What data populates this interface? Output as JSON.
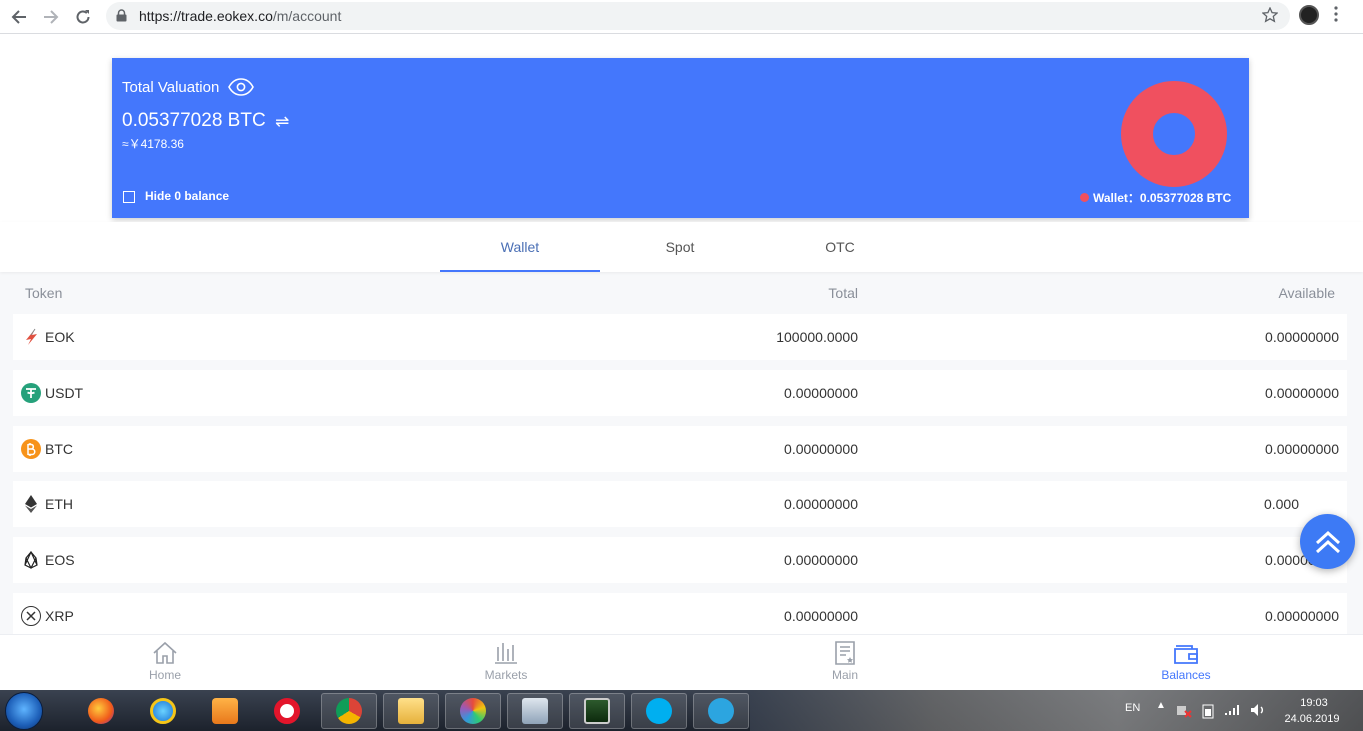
{
  "browser": {
    "url_main": "https://trade.eokex.co",
    "url_path": "/m/account"
  },
  "valuation": {
    "title": "Total Valuation",
    "amount": "0.05377028 BTC",
    "swap_glyph": "⇌",
    "cny": "≈￥4178.36",
    "hide_label": "Hide 0 balance",
    "legend": "Wallet：0.05377028 BTC",
    "colors": {
      "card": "#4477fc",
      "wallet_slice": "#f0505f"
    }
  },
  "tabs": [
    {
      "label": "Wallet",
      "active": true
    },
    {
      "label": "Spot",
      "active": false
    },
    {
      "label": "OTC",
      "active": false
    }
  ],
  "table": {
    "headers": {
      "token": "Token",
      "total": "Total",
      "available": "Available"
    },
    "rows": [
      {
        "token": "EOK",
        "total": "100000.0000",
        "available": "0.00000000",
        "icon": "eok-icon"
      },
      {
        "token": "USDT",
        "total": "0.00000000",
        "available": "0.00000000",
        "icon": "usdt-icon"
      },
      {
        "token": "BTC",
        "total": "0.00000000",
        "available": "0.00000000",
        "icon": "btc-icon"
      },
      {
        "token": "ETH",
        "total": "0.00000000",
        "available": "0.000",
        "icon": "eth-icon"
      },
      {
        "token": "EOS",
        "total": "0.00000000",
        "available": "0.00000000",
        "icon": "eos-icon"
      },
      {
        "token": "XRP",
        "total": "0.00000000",
        "available": "0.00000000",
        "icon": "xrp-icon"
      }
    ]
  },
  "bottom_nav": [
    {
      "label": "Home",
      "icon": "home-icon",
      "active": false
    },
    {
      "label": "Markets",
      "icon": "bar-chart-icon",
      "active": false
    },
    {
      "label": "Main",
      "icon": "document-icon",
      "active": false
    },
    {
      "label": "Balances",
      "icon": "wallet-icon",
      "active": true
    }
  ],
  "taskbar": {
    "lang": "EN",
    "tray_arrow": "▲",
    "time": "19:03",
    "date": "24.06.2019"
  }
}
